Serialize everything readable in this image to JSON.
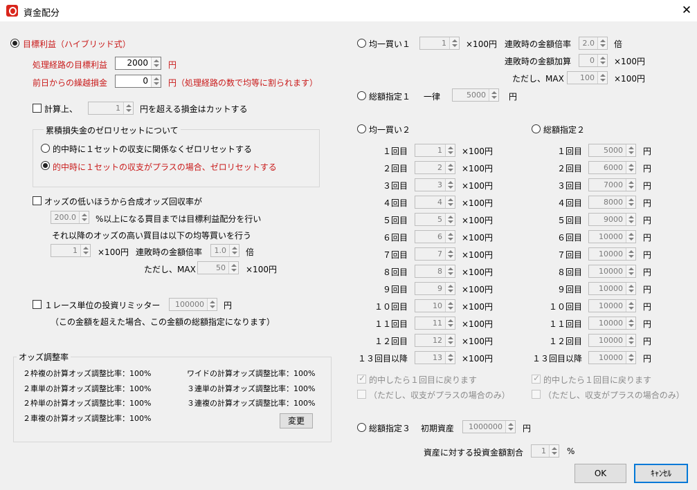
{
  "window": {
    "title": "資金配分",
    "close_glyph": "✕"
  },
  "target": {
    "label": "目標利益（ハイブリッド式）",
    "route_label": "処理経路の目標利益",
    "route_value": "2000",
    "route_unit": "円",
    "carry_label": "前日からの繰越損金",
    "carry_value": "0",
    "carry_unit": "円（処理経路の数で均等に割られます）",
    "cut_prefix": "計算上、",
    "cut_value": "1",
    "cut_suffix": "円を超える損金はカットする",
    "reset_group": "累積損失金のゼロリセットについて",
    "reset_opt1": "的中時に１セットの収支に関係なくゼロリセットする",
    "reset_opt2": "的中時に１セットの収支がプラスの場合、ゼロリセットする",
    "odds_label": "オッズの低いほうから合成オッズ回収率が",
    "odds_value": "200.0",
    "odds_suffix": "%以上になる買目までは目標利益配分を行い",
    "odds_line2": "それ以降のオッズの高い買目は以下の均等買いを行う",
    "even_value": "1",
    "even_unit": "×100円",
    "mult_label": "連敗時の金額倍率",
    "mult_value": "1.0",
    "mult_unit": "倍",
    "max_label": "ただし、MAX",
    "max_value": "50",
    "max_unit": "×100円",
    "limiter_label": "１レース単位の投資リミッター",
    "limiter_value": "100000",
    "limiter_unit": "円",
    "limiter_note": "（この金額を超えた場合、この金額の総額指定になります）"
  },
  "odds_adjust": {
    "title": "オッズ調整率",
    "left": [
      "２枠複の計算オッズ調整比率：100%",
      "２車単の計算オッズ調整比率：100%",
      "２枠単の計算オッズ調整比率：100%",
      "２車複の計算オッズ調整比率：100%"
    ],
    "right": [
      "ワイドの計算オッズ調整比率：100%",
      "３連単の計算オッズ調整比率：100%",
      "３連複の計算オッズ調整比率：100%"
    ],
    "change_button": "変更"
  },
  "even1": {
    "label": "均一買い１",
    "value": "1",
    "unit": "×100円",
    "mult_label": "連敗時の金額倍率",
    "mult_value": "2.0",
    "mult_unit": "倍",
    "add_label": "連敗時の金額加算",
    "add_value": "0",
    "add_unit": "×100円",
    "max_label": "ただし、MAX",
    "max_value": "100",
    "max_unit": "×100円"
  },
  "total1": {
    "label": "総額指定１",
    "sub": "一律",
    "value": "5000",
    "unit": "円"
  },
  "even2": {
    "label": "均一買い２",
    "unit": "×100円",
    "rows": [
      {
        "label": "１回目",
        "value": "1"
      },
      {
        "label": "２回目",
        "value": "2"
      },
      {
        "label": "３回目",
        "value": "3"
      },
      {
        "label": "４回目",
        "value": "4"
      },
      {
        "label": "５回目",
        "value": "5"
      },
      {
        "label": "６回目",
        "value": "6"
      },
      {
        "label": "７回目",
        "value": "7"
      },
      {
        "label": "８回目",
        "value": "8"
      },
      {
        "label": "９回目",
        "value": "9"
      },
      {
        "label": "１０回目",
        "value": "10"
      },
      {
        "label": "１１回目",
        "value": "11"
      },
      {
        "label": "１２回目",
        "value": "12"
      },
      {
        "label": "１３回目以降",
        "value": "13"
      }
    ],
    "back_label": "的中したら１回目に戻ります",
    "plus_label": "（ただし、収支がプラスの場合のみ）"
  },
  "total2": {
    "label": "総額指定２",
    "unit": "円",
    "rows": [
      {
        "label": "１回目",
        "value": "5000"
      },
      {
        "label": "２回目",
        "value": "6000"
      },
      {
        "label": "３回目",
        "value": "7000"
      },
      {
        "label": "４回目",
        "value": "8000"
      },
      {
        "label": "５回目",
        "value": "9000"
      },
      {
        "label": "６回目",
        "value": "10000"
      },
      {
        "label": "７回目",
        "value": "10000"
      },
      {
        "label": "８回目",
        "value": "10000"
      },
      {
        "label": "９回目",
        "value": "10000"
      },
      {
        "label": "１０回目",
        "value": "10000"
      },
      {
        "label": "１１回目",
        "value": "10000"
      },
      {
        "label": "１２回目",
        "value": "10000"
      },
      {
        "label": "１３回目以降",
        "value": "10000"
      }
    ],
    "back_label": "的中したら１回目に戻ります",
    "plus_label": "（ただし、収支がプラスの場合のみ）"
  },
  "total3": {
    "label": "総額指定３",
    "initial_label": "初期資産",
    "initial_value": "1000000",
    "initial_unit": "円",
    "ratio_label": "資産に対する投資金額割合",
    "ratio_value": "1",
    "ratio_unit": "%"
  },
  "buttons": {
    "ok": "OK",
    "cancel": "ｷｬﾝｾﾙ"
  }
}
